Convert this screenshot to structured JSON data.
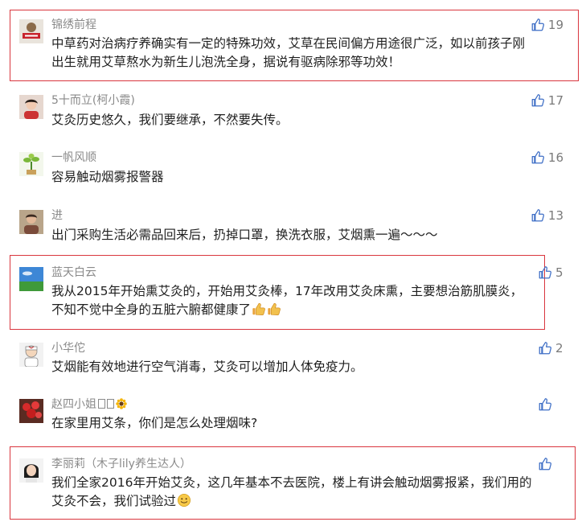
{
  "colors": {
    "highlight_border": "#d9363e",
    "name_text": "#8a8a8a",
    "body_text": "#1f1f1f",
    "like_icon": "#3f6fc6"
  },
  "comments": [
    {
      "name": "锦绣前程",
      "body": "中草药对治病疗养确实有一定的特殊功效，艾草在民间偏方用途很广泛，如以前孩子刚\n出生就用艾草熬水为新生儿泡洗全身，据说有驱病除邪等功效！",
      "likes": "19",
      "highlighted": true,
      "avatar_icon": "news-badge-avatar"
    },
    {
      "name": "5十而立(柯小霞)",
      "body": "艾灸历史悠久，我们要继承，不然要失传。",
      "likes": "17",
      "highlighted": false,
      "avatar_icon": "woman-portrait-avatar"
    },
    {
      "name": "一帆风顺",
      "body": "容易触动烟雾报警器",
      "likes": "16",
      "highlighted": false,
      "avatar_icon": "plant-avatar"
    },
    {
      "name": "进",
      "body": "出门采购生活必需品回来后，扔掉口罩，换洗衣服，艾烟熏一遍～～～",
      "likes": "13",
      "highlighted": false,
      "avatar_icon": "person-portrait-avatar"
    },
    {
      "name": "蓝天白云",
      "body": "我从2015年开始熏艾灸的，开始用艾灸棒，17年改用艾灸床熏，主要想治筋肌膜炎，\n不知不觉中全身的五脏六腑都健康了",
      "body_emoji": [
        "thumbs-up-emoji",
        "thumbs-up-emoji"
      ],
      "likes": "5",
      "highlighted": true,
      "avatar_icon": "sky-landscape-avatar"
    },
    {
      "name": "小华佗",
      "body": "艾烟能有效地进行空气消毒，艾灸可以增加人体免疫力。",
      "likes": "2",
      "highlighted": false,
      "avatar_icon": "cartoon-doctor-avatar"
    },
    {
      "name": "赵四小姐",
      "name_suffix_icons": [
        "missing-glyph-box",
        "missing-glyph-box",
        "sunflower-emoji"
      ],
      "body": "在家里用艾条，你们是怎么处理烟味?",
      "likes": "",
      "highlighted": false,
      "avatar_icon": "red-flowers-avatar"
    },
    {
      "name": "李丽莉（木子lily养生达人）",
      "body": "我们全家2016年开始艾灸，这几年基本不去医院，楼上有讲会触动烟雾报紧，我们用的\n艾灸不会，我们试验过",
      "body_emoji": [
        "smile-emoji"
      ],
      "likes": "",
      "highlighted": true,
      "avatar_icon": "woman-face-avatar"
    }
  ]
}
